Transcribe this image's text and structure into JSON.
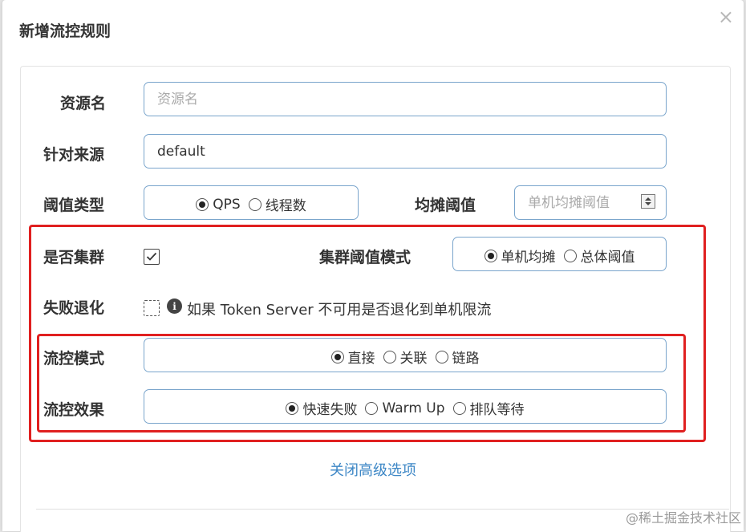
{
  "dialog": {
    "title": "新增流控规则",
    "close_symbol": "×"
  },
  "form": {
    "resource": {
      "label": "资源名",
      "placeholder": "资源名",
      "value": ""
    },
    "origin": {
      "label": "针对来源",
      "value": "default"
    },
    "threshold_type": {
      "label": "阈值类型",
      "options": [
        {
          "label": "QPS",
          "checked": true
        },
        {
          "label": "线程数",
          "checked": false
        }
      ]
    },
    "share_threshold": {
      "label": "均摊阈值",
      "placeholder": "单机均摊阈值"
    },
    "cluster": {
      "label": "是否集群",
      "checked": true
    },
    "cluster_threshold_mode": {
      "label": "集群阈值模式",
      "options": [
        {
          "label": "单机均摊",
          "checked": true
        },
        {
          "label": "总体阈值",
          "checked": false
        }
      ]
    },
    "fallback": {
      "label": "失败退化",
      "checked": false,
      "info_symbol": "i",
      "hint": "如果 Token Server 不可用是否退化到单机限流"
    },
    "control_mode": {
      "label": "流控模式",
      "options": [
        {
          "label": "直接",
          "checked": true
        },
        {
          "label": "关联",
          "checked": false
        },
        {
          "label": "链路",
          "checked": false
        }
      ]
    },
    "control_effect": {
      "label": "流控效果",
      "options": [
        {
          "label": "快速失败",
          "checked": true
        },
        {
          "label": "Warm Up",
          "checked": false
        },
        {
          "label": "排队等待",
          "checked": false
        }
      ]
    },
    "advanced_toggle": "关闭高级选项"
  },
  "watermark": "@稀土掘金技术社区",
  "colors": {
    "highlight": "#e02020",
    "input_border": "#7aa5cc",
    "link": "#3d87c6"
  }
}
